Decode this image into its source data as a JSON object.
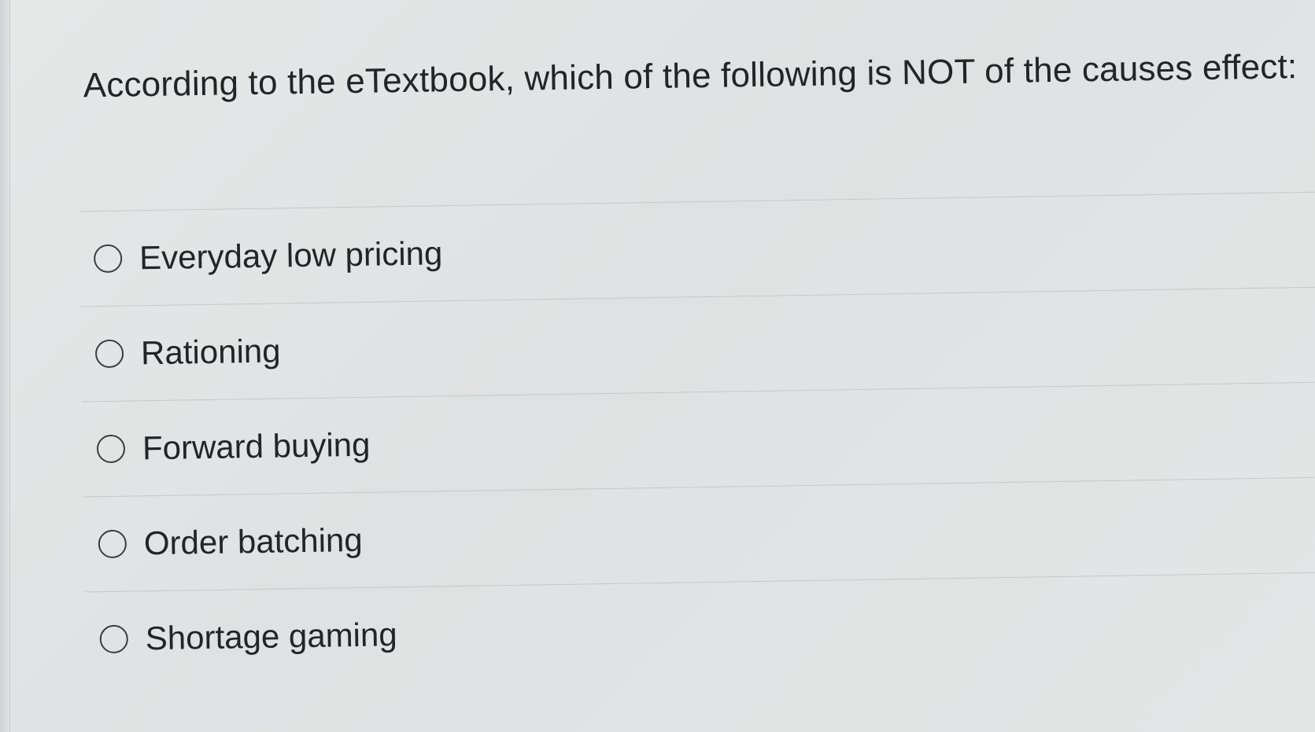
{
  "question": {
    "text": "According to the eTextbook, which of the following is NOT of the causes effect:"
  },
  "options": [
    {
      "label": "Everyday low pricing",
      "selected": false
    },
    {
      "label": "Rationing",
      "selected": false
    },
    {
      "label": "Forward buying",
      "selected": false
    },
    {
      "label": "Order batching",
      "selected": false
    },
    {
      "label": "Shortage gaming",
      "selected": false
    }
  ],
  "colors": {
    "background": "#e2e5e5",
    "text": "#222526",
    "divider": "#c5c9c9",
    "radio_border": "#3a3d3f"
  }
}
